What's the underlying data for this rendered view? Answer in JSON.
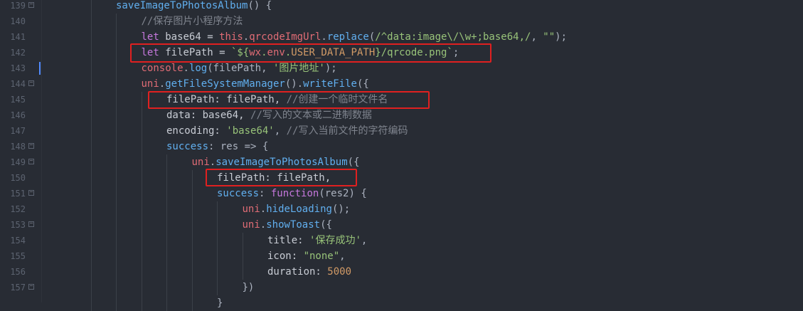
{
  "lines": [
    {
      "n": "139",
      "fold": true,
      "indent": 2,
      "tokens": [
        [
          "fn",
          "saveImageToPhotosAlbum"
        ],
        [
          "pun",
          "() {"
        ]
      ]
    },
    {
      "n": "140",
      "fold": false,
      "indent": 3,
      "tokens": [
        [
          "cmt",
          "//保存图片小程序方法"
        ]
      ]
    },
    {
      "n": "141",
      "fold": false,
      "indent": 3,
      "tokens": [
        [
          "kw",
          "let "
        ],
        [
          "prop",
          "base64 = "
        ],
        [
          "vr",
          "this"
        ],
        [
          "pun",
          "."
        ],
        [
          "vr",
          "qrcodeImgUrl"
        ],
        [
          "pun",
          "."
        ],
        [
          "fn",
          "replace"
        ],
        [
          "pun",
          "("
        ],
        [
          "str",
          "/^data:image\\/\\w+;base64,/"
        ],
        [
          "pun",
          ", "
        ],
        [
          "str",
          "\"\""
        ],
        [
          "pun",
          ");"
        ]
      ]
    },
    {
      "n": "142",
      "fold": false,
      "indent": 3,
      "tokens": [
        [
          "kw",
          "let "
        ],
        [
          "prop",
          "filePath = "
        ],
        [
          "str",
          "`${"
        ],
        [
          "vr",
          "wx"
        ],
        [
          "str",
          "."
        ],
        [
          "vr",
          "env"
        ],
        [
          "str",
          "."
        ],
        [
          "num",
          "USER_DATA_PATH"
        ],
        [
          "str",
          "}/qrcode.png`"
        ],
        [
          "pun",
          ";"
        ]
      ]
    },
    {
      "n": "143",
      "fold": false,
      "indent": 3,
      "tokens": [
        [
          "vr",
          "console"
        ],
        [
          "pun",
          "."
        ],
        [
          "fn",
          "log"
        ],
        [
          "pun",
          "(filePath, "
        ],
        [
          "str",
          "'图片地址'"
        ],
        [
          "pun",
          ");"
        ]
      ]
    },
    {
      "n": "144",
      "fold": true,
      "indent": 3,
      "tokens": [
        [
          "vr",
          "uni"
        ],
        [
          "pun",
          "."
        ],
        [
          "fn",
          "getFileSystemManager"
        ],
        [
          "pun",
          "()."
        ],
        [
          "fn",
          "writeFile"
        ],
        [
          "pun",
          "({"
        ]
      ]
    },
    {
      "n": "145",
      "fold": false,
      "indent": 4,
      "tokens": [
        [
          "key",
          "filePath: filePath, "
        ],
        [
          "cmt",
          "//创建一个临时文件名"
        ]
      ]
    },
    {
      "n": "146",
      "fold": false,
      "indent": 4,
      "tokens": [
        [
          "key",
          "data: base64, "
        ],
        [
          "cmt",
          "//写入的文本或二进制数据"
        ]
      ]
    },
    {
      "n": "147",
      "fold": false,
      "indent": 4,
      "tokens": [
        [
          "key",
          "encoding: "
        ],
        [
          "str",
          "'base64'"
        ],
        [
          "pun",
          ", "
        ],
        [
          "cmt",
          "//写入当前文件的字符编码"
        ]
      ]
    },
    {
      "n": "148",
      "fold": true,
      "indent": 4,
      "tokens": [
        [
          "fn",
          "success"
        ],
        [
          "pun",
          ": res => {"
        ]
      ]
    },
    {
      "n": "149",
      "fold": true,
      "indent": 5,
      "tokens": [
        [
          "vr",
          "uni"
        ],
        [
          "pun",
          "."
        ],
        [
          "fn",
          "saveImageToPhotosAlbum"
        ],
        [
          "pun",
          "({"
        ]
      ]
    },
    {
      "n": "150",
      "fold": false,
      "indent": 6,
      "tokens": [
        [
          "key",
          "filePath: filePath,"
        ]
      ]
    },
    {
      "n": "151",
      "fold": true,
      "indent": 6,
      "tokens": [
        [
          "fn",
          "success"
        ],
        [
          "pun",
          ": "
        ],
        [
          "kw",
          "function"
        ],
        [
          "pun",
          "(res2) {"
        ]
      ]
    },
    {
      "n": "152",
      "fold": false,
      "indent": 7,
      "tokens": [
        [
          "vr",
          "uni"
        ],
        [
          "pun",
          "."
        ],
        [
          "fn",
          "hideLoading"
        ],
        [
          "pun",
          "();"
        ]
      ]
    },
    {
      "n": "153",
      "fold": true,
      "indent": 7,
      "tokens": [
        [
          "vr",
          "uni"
        ],
        [
          "pun",
          "."
        ],
        [
          "fn",
          "showToast"
        ],
        [
          "pun",
          "({"
        ]
      ]
    },
    {
      "n": "154",
      "fold": false,
      "indent": 8,
      "tokens": [
        [
          "key",
          "title: "
        ],
        [
          "str",
          "'保存成功'"
        ],
        [
          "pun",
          ","
        ]
      ]
    },
    {
      "n": "155",
      "fold": false,
      "indent": 8,
      "tokens": [
        [
          "key",
          "icon: "
        ],
        [
          "str",
          "\"none\""
        ],
        [
          "pun",
          ","
        ]
      ]
    },
    {
      "n": "156",
      "fold": false,
      "indent": 8,
      "tokens": [
        [
          "key",
          "duration: "
        ],
        [
          "num",
          "5000"
        ]
      ]
    },
    {
      "n": "157",
      "fold": true,
      "indent": 7,
      "tokens": [
        [
          "pun",
          "})"
        ]
      ]
    },
    {
      "n": "",
      "fold": false,
      "indent": 6,
      "tokens": [
        [
          "pun",
          "}"
        ]
      ]
    }
  ],
  "colors": {
    "background": "#282c34",
    "highlight_box": "#e02020"
  }
}
